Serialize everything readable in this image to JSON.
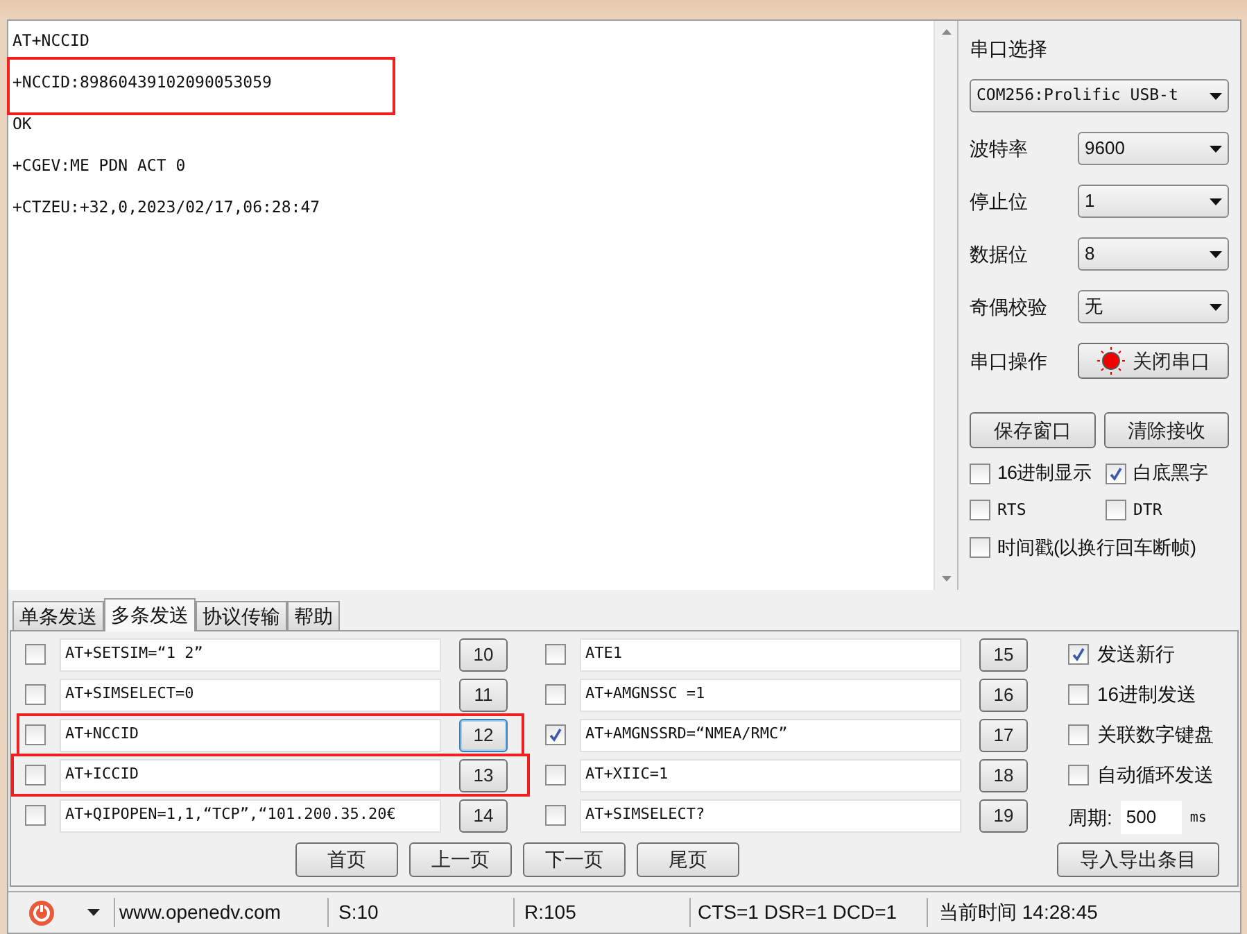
{
  "receive": {
    "lines": [
      {
        "text": "AT+NCCID",
        "highlighted": false
      },
      {
        "text": "+NCCID:89860439102090053059",
        "highlighted": true
      },
      {
        "text": "OK",
        "highlighted": false
      },
      {
        "text": "+CGEV:ME PDN ACT 0",
        "highlighted": false
      },
      {
        "text": "+CTZEU:+32,0,2023/02/17,06:28:47",
        "highlighted": false
      }
    ]
  },
  "serial_panel": {
    "port_label": "串口选择",
    "port_value": "COM256:Prolific USB-t",
    "settings": [
      {
        "label": "波特率",
        "value": "9600"
      },
      {
        "label": "停止位",
        "value": "1"
      },
      {
        "label": "数据位",
        "value": "8"
      },
      {
        "label": "奇偶校验",
        "value": "无"
      }
    ],
    "operation_label": "串口操作",
    "operation_button": "关闭串口",
    "buttons": [
      "保存窗口",
      "清除接收"
    ],
    "options": [
      [
        {
          "label": "16进制显示",
          "checked": false
        },
        {
          "label": "白底黑字",
          "checked": true
        }
      ],
      [
        {
          "label": "RTS",
          "checked": false
        },
        {
          "label": "DTR",
          "checked": false
        }
      ],
      [
        {
          "label": "时间戳(以换行回车断帧)",
          "checked": false
        }
      ]
    ]
  },
  "tabs": [
    {
      "label": "单条发送",
      "selected": false
    },
    {
      "label": "多条发送",
      "selected": true
    },
    {
      "label": "协议传输",
      "selected": false
    },
    {
      "label": "帮助",
      "selected": false
    }
  ],
  "multi_send": {
    "columns": [
      [
        {
          "checked": false,
          "value": "AT+SETSIM=“1 2”",
          "button": "10",
          "highlighted": false,
          "focused": false
        },
        {
          "checked": false,
          "value": "AT+SIMSELECT=0",
          "button": "11",
          "highlighted": false,
          "focused": false
        },
        {
          "checked": false,
          "value": "AT+NCCID",
          "button": "12",
          "highlighted": true,
          "focused": true
        },
        {
          "checked": false,
          "value": "AT+ICCID",
          "button": "13",
          "highlighted": true,
          "focused": false
        },
        {
          "checked": false,
          "value": "AT+QIPOPEN=1,1,“TCP”,“101.200.35.20€",
          "button": "14",
          "highlighted": false,
          "focused": false
        }
      ],
      [
        {
          "checked": false,
          "value": "ATE1",
          "button": "15",
          "highlighted": false,
          "focused": false
        },
        {
          "checked": false,
          "value": "AT+AMGNSSC =1",
          "button": "16",
          "highlighted": false,
          "focused": false
        },
        {
          "checked": true,
          "value": "AT+AMGNSSRD=“NMEA/RMC”",
          "button": "17",
          "highlighted": false,
          "focused": false
        },
        {
          "checked": false,
          "value": "AT+XIIC=1",
          "button": "18",
          "highlighted": false,
          "focused": false
        },
        {
          "checked": false,
          "value": "AT+SIMSELECT?",
          "button": "19",
          "highlighted": false,
          "focused": false
        }
      ]
    ],
    "options": [
      {
        "label": "发送新行",
        "checked": true
      },
      {
        "label": "16进制发送",
        "checked": false
      },
      {
        "label": "关联数字键盘",
        "checked": false
      },
      {
        "label": "自动循环发送",
        "checked": false
      }
    ],
    "period_label": "周期:",
    "period_value": "500",
    "period_unit": "ms",
    "pager": [
      "首页",
      "上一页",
      "下一页",
      "尾页"
    ],
    "import_button": "导入导出条目"
  },
  "status_bar": {
    "url": "www.openedv.com",
    "sent": "S:10",
    "received": "R:105",
    "lines": "CTS=1 DSR=1 DCD=1",
    "time": "当前时间 14:28:45"
  }
}
